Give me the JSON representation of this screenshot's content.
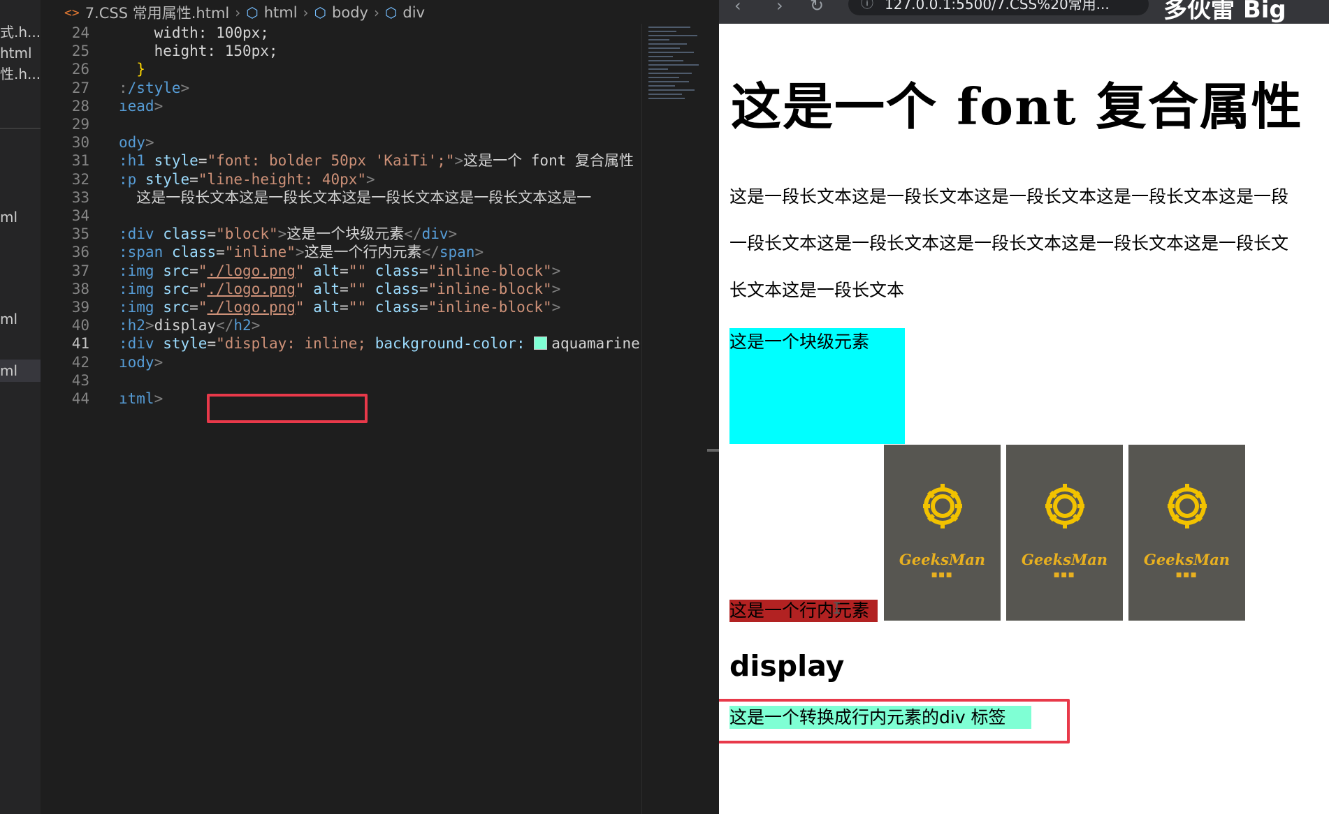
{
  "explorer": {
    "items": [
      "式.h...",
      "html",
      "性.h...",
      "ml",
      "ml",
      "ml"
    ]
  },
  "breadcrumb": {
    "file": "7.CSS 常用属性.html",
    "path": [
      "html",
      "body",
      "div"
    ]
  },
  "editor": {
    "active_line": 41,
    "line_numbers": [
      24,
      25,
      26,
      27,
      28,
      29,
      30,
      31,
      32,
      33,
      34,
      35,
      36,
      37,
      38,
      39,
      40,
      41,
      42,
      43,
      44
    ],
    "lines": [
      {
        "segments": [
          [
            "tx",
            "    width: 100px;"
          ]
        ]
      },
      {
        "segments": [
          [
            "tx",
            "    height: 150px;"
          ]
        ]
      },
      {
        "segments": [
          [
            "br",
            "  }"
          ]
        ]
      },
      {
        "segments": [
          [
            "pu",
            ":"
          ],
          [
            "tg",
            "/style"
          ],
          [
            "pu",
            ">"
          ]
        ]
      },
      {
        "segments": [
          [
            "tg",
            "ıead"
          ],
          [
            "pu",
            ">"
          ]
        ]
      },
      {
        "segments": []
      },
      {
        "segments": [
          [
            "tg",
            "ody"
          ],
          [
            "pu",
            ">"
          ]
        ]
      },
      {
        "segments": [
          [
            "tg",
            ":h1"
          ],
          [
            "tx",
            " "
          ],
          [
            "an",
            "style"
          ],
          [
            "tx",
            "="
          ],
          [
            "av",
            "\"font: bolder 50px 'KaiTi';\""
          ],
          [
            "pu",
            ">"
          ],
          [
            "tx",
            "这是一个 font 复合属性"
          ]
        ]
      },
      {
        "segments": [
          [
            "tg",
            ":p"
          ],
          [
            "tx",
            " "
          ],
          [
            "an",
            "style"
          ],
          [
            "tx",
            "="
          ],
          [
            "av",
            "\"line-height: 40px\""
          ],
          [
            "pu",
            ">"
          ]
        ]
      },
      {
        "segments": [
          [
            "tx",
            "  这是一段长文本这是一段长文本这是一段长文本这是一段长文本这是一"
          ]
        ]
      },
      {
        "segments": []
      },
      {
        "segments": [
          [
            "tg",
            ":div"
          ],
          [
            "tx",
            " "
          ],
          [
            "an",
            "class"
          ],
          [
            "tx",
            "="
          ],
          [
            "av",
            "\"block\""
          ],
          [
            "pu",
            ">"
          ],
          [
            "tx",
            "这是一个块级元素"
          ],
          [
            "pu",
            "</"
          ],
          [
            "tg",
            "div"
          ],
          [
            "pu",
            ">"
          ]
        ]
      },
      {
        "segments": [
          [
            "tg",
            ":span"
          ],
          [
            "tx",
            " "
          ],
          [
            "an",
            "class"
          ],
          [
            "tx",
            "="
          ],
          [
            "av",
            "\"inline\""
          ],
          [
            "pu",
            ">"
          ],
          [
            "tx",
            "这是一个行内元素"
          ],
          [
            "pu",
            "</"
          ],
          [
            "tg",
            "span"
          ],
          [
            "pu",
            ">"
          ]
        ]
      },
      {
        "segments": [
          [
            "tg",
            ":img"
          ],
          [
            "tx",
            " "
          ],
          [
            "an",
            "src"
          ],
          [
            "tx",
            "="
          ],
          [
            "av",
            "\""
          ],
          [
            "avu",
            "./logo.png"
          ],
          [
            "av",
            "\""
          ],
          [
            "tx",
            " "
          ],
          [
            "an",
            "alt"
          ],
          [
            "tx",
            "="
          ],
          [
            "av",
            "\"\""
          ],
          [
            "tx",
            " "
          ],
          [
            "an",
            "class"
          ],
          [
            "tx",
            "="
          ],
          [
            "av",
            "\"inline-block\""
          ],
          [
            "pu",
            ">"
          ]
        ]
      },
      {
        "segments": [
          [
            "tg",
            ":img"
          ],
          [
            "tx",
            " "
          ],
          [
            "an",
            "src"
          ],
          [
            "tx",
            "="
          ],
          [
            "av",
            "\""
          ],
          [
            "avu",
            "./logo.png"
          ],
          [
            "av",
            "\""
          ],
          [
            "tx",
            " "
          ],
          [
            "an",
            "alt"
          ],
          [
            "tx",
            "="
          ],
          [
            "av",
            "\"\""
          ],
          [
            "tx",
            " "
          ],
          [
            "an",
            "class"
          ],
          [
            "tx",
            "="
          ],
          [
            "av",
            "\"inline-block\""
          ],
          [
            "pu",
            ">"
          ]
        ]
      },
      {
        "segments": [
          [
            "tg",
            ":img"
          ],
          [
            "tx",
            " "
          ],
          [
            "an",
            "src"
          ],
          [
            "tx",
            "="
          ],
          [
            "av",
            "\""
          ],
          [
            "avu",
            "./logo.png"
          ],
          [
            "av",
            "\""
          ],
          [
            "tx",
            " "
          ],
          [
            "an",
            "alt"
          ],
          [
            "tx",
            "="
          ],
          [
            "av",
            "\"\""
          ],
          [
            "tx",
            " "
          ],
          [
            "an",
            "class"
          ],
          [
            "tx",
            "="
          ],
          [
            "av",
            "\"inline-block\""
          ],
          [
            "pu",
            ">"
          ]
        ]
      },
      {
        "segments": [
          [
            "tg",
            ":h2"
          ],
          [
            "pu",
            ">"
          ],
          [
            "tx",
            "display"
          ],
          [
            "pu",
            "</"
          ],
          [
            "tg",
            "h2"
          ],
          [
            "pu",
            ">"
          ]
        ]
      },
      {
        "segments": [
          [
            "tg",
            ":div"
          ],
          [
            "tx",
            " "
          ],
          [
            "an",
            "style"
          ],
          [
            "tx",
            "="
          ],
          [
            "av",
            "\"display: inline;"
          ],
          [
            "tx",
            " "
          ],
          [
            "an",
            "background-color:"
          ],
          [
            "tx",
            " "
          ],
          [
            "sw",
            ""
          ],
          [
            "tx",
            "aquamarine"
          ]
        ]
      },
      {
        "segments": [
          [
            "tg",
            "ıody"
          ],
          [
            "pu",
            ">"
          ]
        ]
      },
      {
        "segments": []
      },
      {
        "segments": [
          [
            "tg",
            "ıtml"
          ],
          [
            "pu",
            ">"
          ]
        ]
      }
    ]
  },
  "browser": {
    "address": "127.0.0.1:5500/7.CSS%20常用...",
    "tab_title": "多伙雷 Big"
  },
  "page": {
    "h1": "这是一个 font 复合属性",
    "paragraph_lines": [
      "这是一段长文本这是一段长文本这是一段长文本这是一段长文本这是一段",
      "一段长文本这是一段长文本这是一段长文本这是一段长文本这是一段长文",
      "长文本这是一段长文本"
    ],
    "block_text": "这是一个块级元素",
    "inline_text": "这是一个行内元素",
    "logo_brand": "GeeksMan",
    "logo_dots": "■■■",
    "h2": "display",
    "inline_div_text": "这是一个转换成行内元素的div 标签"
  },
  "colors": {
    "block_bg": "#00ffff",
    "inline_bg": "#b22222",
    "inline_div_bg": "#7fffd4",
    "highlight_border": "#e8394a",
    "logo_bg": "#575651"
  }
}
